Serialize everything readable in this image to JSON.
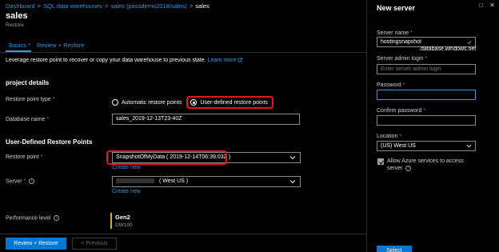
{
  "colors": {
    "accent": "#3a96dd",
    "primary_button": "#0078d4",
    "highlight": "#e81123",
    "required": "#ff5c5c",
    "perf_bar": "#d8b100"
  },
  "breadcrumb": {
    "items": [
      "Dashboard",
      "SQL data warehouses",
      "sales (passdemo2018/sales)"
    ],
    "current": "sales",
    "separator": ">"
  },
  "header": {
    "title": "sales",
    "subtitle": "Restore"
  },
  "tabs": [
    {
      "label": "Basics",
      "suffix": "*"
    },
    {
      "label": "Review + Restore"
    }
  ],
  "intro": {
    "text": "Leverage restore point to recover or copy your data warehouse to previous state.",
    "link": "Learn more"
  },
  "project_details": {
    "heading": "project details",
    "restore_point_type_label": "Restore point type",
    "options": [
      "Automatic restore points",
      "User-defined restore points"
    ],
    "selected": "User-defined restore points",
    "database_name_label": "Database name",
    "database_name_value": "sales_2019-12-13T23-40Z"
  },
  "user_defined": {
    "heading": "User-Defined Restore Points",
    "restore_point_label": "Restore point",
    "restore_point_value": "SnapshotOfMyData ( 2019-12-14T06:39:03Z )",
    "create_new": "Create new",
    "server_label": "Server",
    "server_value": "( West US )",
    "server_create_new": "Create new",
    "performance_label": "Performance level",
    "performance_value": "Gen2",
    "performance_sub": "DW100"
  },
  "footer": {
    "primary": "Review + Restore",
    "secondary": "< Previous"
  },
  "panel": {
    "title": "New server",
    "minimize_icon": "minimize-icon",
    "close_icon": "close-icon",
    "server_name_label": "Server name",
    "server_name_value": "hostingsnapshot",
    "server_name_suffix": ".database.windows.net",
    "admin_login_label": "Server admin login",
    "admin_login_placeholder": "Enter server admin login",
    "password_label": "Password",
    "confirm_password_label": "Confirm password",
    "location_label": "Location",
    "location_value": "(US) West US",
    "allow_azure_label": "Allow Azure services to access server",
    "allow_azure_checked": true,
    "select_button": "Select"
  }
}
